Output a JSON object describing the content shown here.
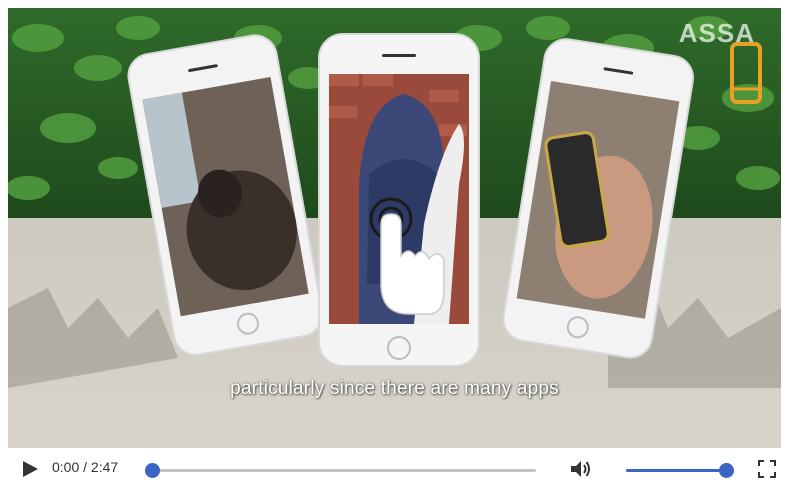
{
  "video": {
    "caption": "particularly since there are many apps",
    "watermark_text": "ASSA",
    "watermark_icon": "phone-icon"
  },
  "controls": {
    "play_icon": "play-icon",
    "current_time": "0:00",
    "separator": "/",
    "duration": "2:47",
    "progress": 0.0,
    "volume_icon": "volume-icon",
    "volume_level": 1.0,
    "fullscreen_icon": "fullscreen-icon",
    "accent_color": "#3b64c4"
  }
}
